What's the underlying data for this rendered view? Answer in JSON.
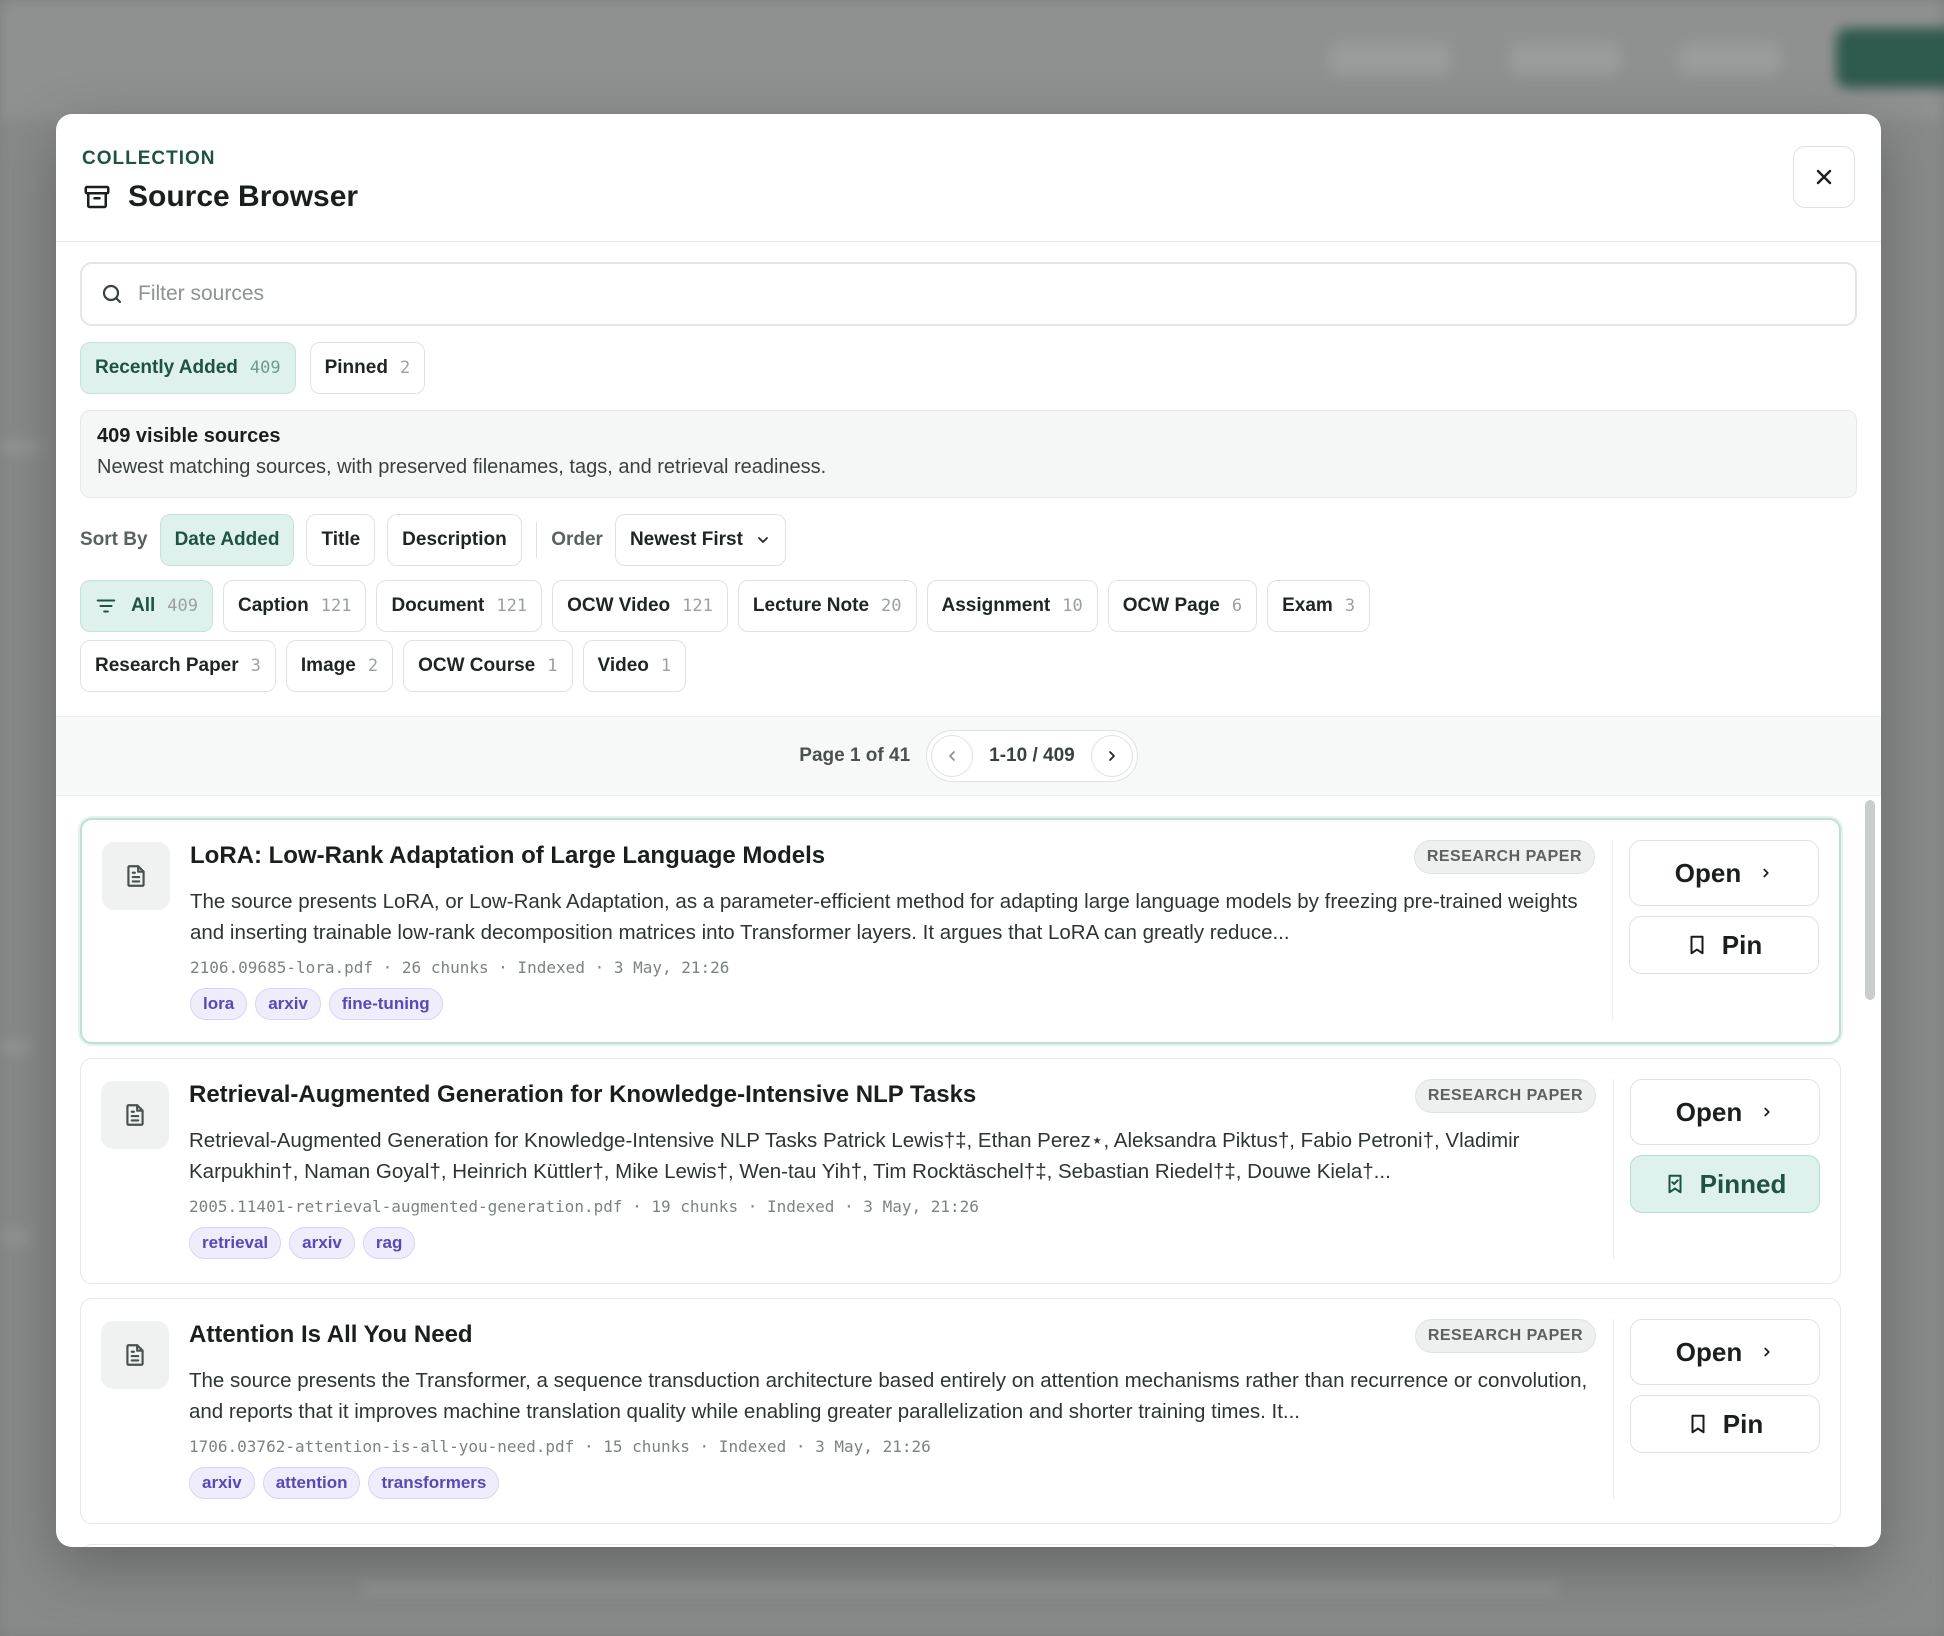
{
  "modal": {
    "eyebrow": "COLLECTION",
    "title": "Source Browser"
  },
  "search": {
    "placeholder": "Filter sources",
    "value": ""
  },
  "tabs": [
    {
      "label": "Recently Added",
      "count": "409",
      "active": true
    },
    {
      "label": "Pinned",
      "count": "2",
      "active": false
    }
  ],
  "summary": {
    "headline": "409 visible sources",
    "detail": "Newest matching sources, with preserved filenames, tags, and retrieval readiness."
  },
  "sort": {
    "label": "Sort By",
    "options": [
      {
        "label": "Date Added",
        "active": true
      },
      {
        "label": "Title",
        "active": false
      },
      {
        "label": "Description",
        "active": false
      }
    ],
    "order_label": "Order",
    "order_value": "Newest First"
  },
  "type_filters": [
    {
      "label": "All",
      "count": "409",
      "active": true
    },
    {
      "label": "Caption",
      "count": "121"
    },
    {
      "label": "Document",
      "count": "121"
    },
    {
      "label": "OCW Video",
      "count": "121"
    },
    {
      "label": "Lecture Note",
      "count": "20"
    },
    {
      "label": "Assignment",
      "count": "10"
    },
    {
      "label": "OCW Page",
      "count": "6"
    },
    {
      "label": "Exam",
      "count": "3"
    },
    {
      "label": "Research Paper",
      "count": "3"
    },
    {
      "label": "Image",
      "count": "2"
    },
    {
      "label": "OCW Course",
      "count": "1"
    },
    {
      "label": "Video",
      "count": "1"
    }
  ],
  "pagination": {
    "page_label": "Page 1 of 41",
    "range": "1-10 / 409"
  },
  "sources": [
    {
      "title": "LoRA: Low-Rank Adaptation of Large Language Models",
      "type": "RESEARCH PAPER",
      "description": "The source presents LoRA, or Low-Rank Adaptation, as a parameter-efficient method for adapting large language models by freezing pre-trained weights and inserting trainable low-rank decomposition matrices into Transformer layers. It argues that LoRA can greatly reduce...",
      "meta": "2106.09685-lora.pdf · 26 chunks · Indexed · 3 May, 21:26",
      "tags": [
        "lora",
        "arxiv",
        "fine-tuning"
      ],
      "open_label": "Open",
      "pin_label": "Pin",
      "pinned": false
    },
    {
      "title": "Retrieval-Augmented Generation for Knowledge-Intensive NLP Tasks",
      "type": "RESEARCH PAPER",
      "description": "Retrieval-Augmented Generation for Knowledge-Intensive NLP Tasks Patrick Lewis†‡, Ethan Perez⋆, Aleksandra Piktus†, Fabio Petroni†, Vladimir Karpukhin†, Naman Goyal†, Heinrich Küttler†, Mike Lewis†, Wen-tau Yih†, Tim Rocktäschel†‡, Sebastian Riedel†‡, Douwe Kiela†...",
      "meta": "2005.11401-retrieval-augmented-generation.pdf · 19 chunks · Indexed · 3 May, 21:26",
      "tags": [
        "retrieval",
        "arxiv",
        "rag"
      ],
      "open_label": "Open",
      "pin_label": "Pinned",
      "pinned": true
    },
    {
      "title": "Attention Is All You Need",
      "type": "RESEARCH PAPER",
      "description": "The source presents the Transformer, a sequence transduction architecture based entirely on attention mechanisms rather than recurrence or convolution, and reports that it improves machine translation quality while enabling greater parallelization and shorter training times. It...",
      "meta": "1706.03762-attention-is-all-you-need.pdf · 15 chunks · Indexed · 3 May, 21:26",
      "tags": [
        "arxiv",
        "attention",
        "transformers"
      ],
      "open_label": "Open",
      "pin_label": "Pin",
      "pinned": false
    }
  ],
  "colors": {
    "accent": "#1e5245",
    "accent_bg": "#dff1ec",
    "tag_text": "#5a47b8",
    "tag_bg": "#efedfb"
  }
}
